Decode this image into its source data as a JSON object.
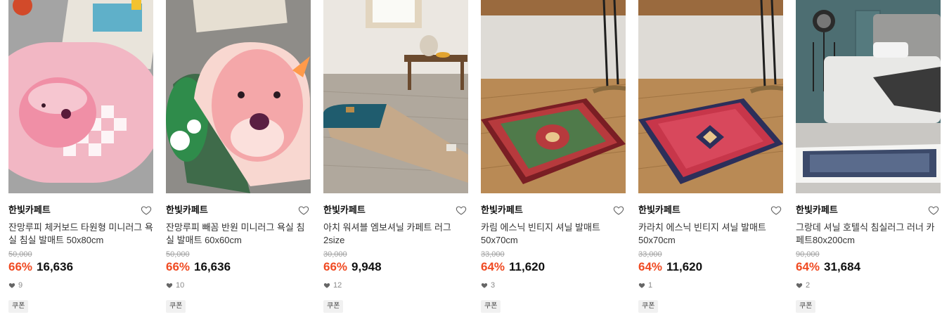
{
  "colors": {
    "discount": "#f04b23",
    "price": "#111111",
    "strike": "#a0a0a0"
  },
  "products": [
    {
      "brand": "한빛카페트",
      "title": "잔망루피 체커보드 타원형 미니러그 욕실 침실 발매트 50x80cm",
      "original_price": "50,000",
      "discount": "66%",
      "price": "16,636",
      "likes": "9",
      "badge": "쿠폰",
      "image": "pink-checker-oval-rug-photo"
    },
    {
      "brand": "한빛카페트",
      "title": "잔망루피 빼꼼 반원 미니러그 욕실 침실 발매트 60x60cm",
      "original_price": "50,000",
      "discount": "66%",
      "price": "16,636",
      "likes": "10",
      "badge": "쿠폰",
      "image": "pink-character-round-rug-photo"
    },
    {
      "brand": "한빛카페트",
      "title": "아치 워셔블 엠보셔닐 카페트 러그 2size",
      "original_price": "30,000",
      "discount": "66%",
      "price": "9,948",
      "likes": "12",
      "badge": "쿠폰",
      "image": "arch-runner-rug-photo"
    },
    {
      "brand": "한빛카페트",
      "title": "카림 에스닉 빈티지 셔닐 발매트 50x70cm",
      "original_price": "33,000",
      "discount": "64%",
      "price": "11,620",
      "likes": "3",
      "badge": "쿠폰",
      "image": "green-persian-mat-photo"
    },
    {
      "brand": "한빛카페트",
      "title": "카라치 에스닉 빈티지 셔닐 발매트 50x70cm",
      "original_price": "33,000",
      "discount": "64%",
      "price": "11,620",
      "likes": "1",
      "badge": "쿠폰",
      "image": "red-persian-mat-photo"
    },
    {
      "brand": "한빛카페트",
      "title": "그랑데 셔닐 호텔식 침실러그 러너 카페트80x200cm",
      "original_price": "90,000",
      "discount": "64%",
      "price": "31,684",
      "likes": "2",
      "badge": "쿠폰",
      "image": "bedroom-runner-rug-photo"
    }
  ]
}
